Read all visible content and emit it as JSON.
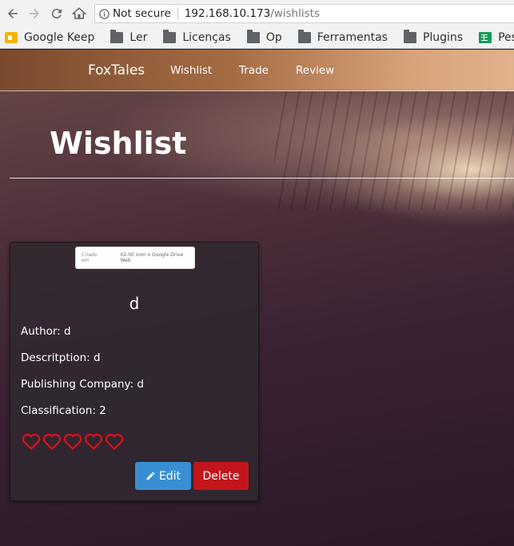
{
  "browser": {
    "security_label": "Not secure",
    "url_host": "192.168.10.173",
    "url_path": "/wishlists",
    "bookmarks": [
      {
        "label": "Google Keep",
        "icon": "google-keep-icon"
      },
      {
        "label": "Ler",
        "icon": "folder-icon"
      },
      {
        "label": "Licenças",
        "icon": "folder-icon"
      },
      {
        "label": "Op",
        "icon": "folder-icon"
      },
      {
        "label": "Ferramentas",
        "icon": "folder-icon"
      },
      {
        "label": "Plugins",
        "icon": "folder-icon"
      },
      {
        "label": "Pesquisa com",
        "icon": "google-sheets-icon"
      }
    ]
  },
  "navbar": {
    "brand": "FoxTales",
    "links": [
      "Wishlist",
      "Trade",
      "Review"
    ]
  },
  "page": {
    "title": "Wishlist"
  },
  "card": {
    "image_text_left": "Criado em",
    "image_text_right": "02:00 com o Google Drive Web",
    "name": "d",
    "author": "Author: d",
    "description": "Descritption: d",
    "publishing_company": "Publishing Company: d",
    "classification": "Classification: 2",
    "hearts_count": 5,
    "heart_color": "#e0101a",
    "edit_label": "Edit",
    "delete_label": "Delete"
  },
  "colors": {
    "edit_button": "#3a8fd3",
    "delete_button": "#c2161c"
  }
}
